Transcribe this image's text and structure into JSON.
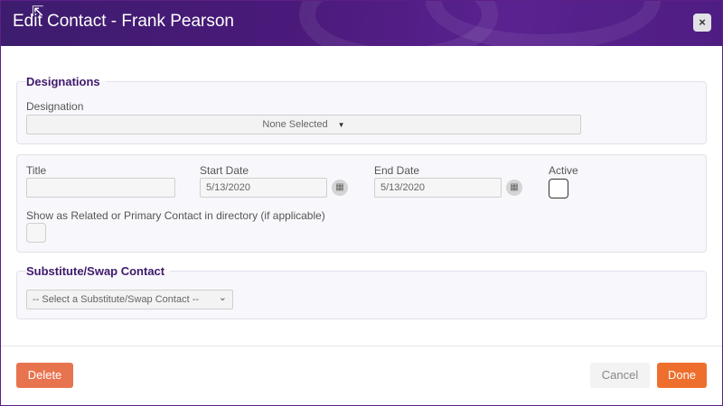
{
  "dialog": {
    "title": "Edit Contact - Frank Pearson",
    "close_label": "×",
    "move_icon": "⇱"
  },
  "designations": {
    "legend": "Designations",
    "designation_label": "Designation",
    "designation_value": "None Selected",
    "caret": "▼"
  },
  "details": {
    "title_label": "Title",
    "title_value": "",
    "start_label": "Start Date",
    "start_value": "5/13/2020",
    "end_label": "End Date",
    "end_value": "5/13/2020",
    "active_label": "Active",
    "show_related_label": "Show as Related or Primary Contact in directory (if applicable)",
    "calendar_icon": "▦"
  },
  "substitute": {
    "legend": "Substitute/Swap Contact",
    "select_value": "-- Select a Substitute/Swap Contact --",
    "chevron": "⌄"
  },
  "footer": {
    "delete_label": "Delete",
    "cancel_label": "Cancel",
    "done_label": "Done"
  },
  "colors": {
    "header": "#4a1a7a",
    "accent_orange": "#ee6f2d",
    "delete": "#e8744f"
  }
}
